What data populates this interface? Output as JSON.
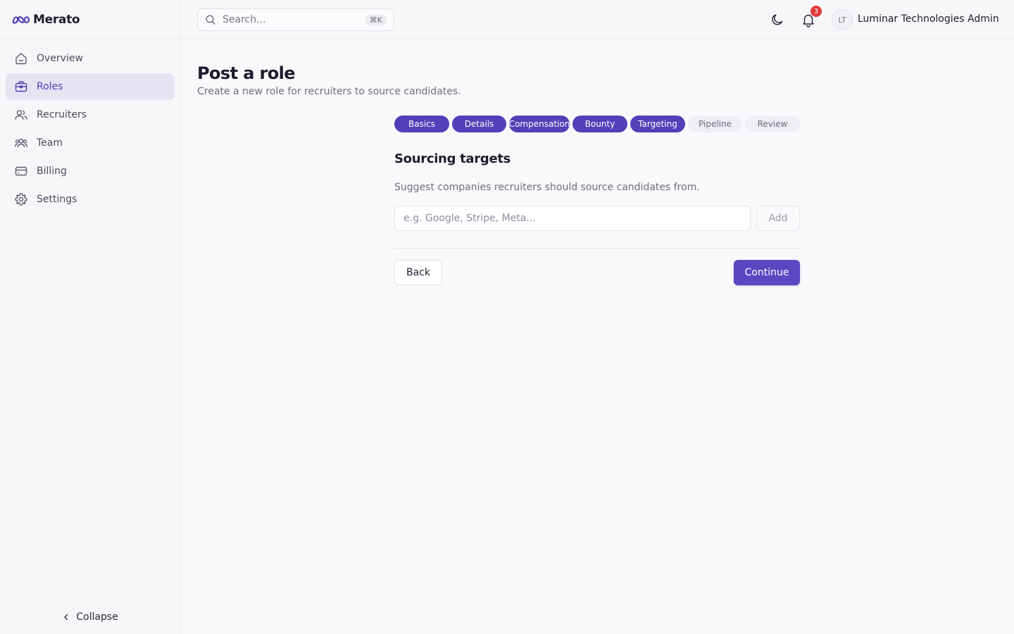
{
  "brand": {
    "name": "Merato",
    "accent": "#5140b8"
  },
  "sidebar": {
    "items": [
      {
        "label": "Overview",
        "icon": "home-icon",
        "active": false
      },
      {
        "label": "Roles",
        "icon": "briefcase-icon",
        "active": true
      },
      {
        "label": "Recruiters",
        "icon": "users-icon",
        "active": false
      },
      {
        "label": "Team",
        "icon": "team-icon",
        "active": false
      },
      {
        "label": "Billing",
        "icon": "credit-card-icon",
        "active": false
      },
      {
        "label": "Settings",
        "icon": "gear-icon",
        "active": false
      }
    ],
    "collapse_label": "Collapse"
  },
  "topbar": {
    "search_placeholder": "Search...",
    "search_shortcut": "⌘K",
    "notification_count": "3",
    "avatar_initials": "LT",
    "user_name": "Luminar Technologies Admin"
  },
  "page": {
    "title": "Post a role",
    "subtitle": "Create a new role for recruiters to source candidates."
  },
  "steps": [
    {
      "label": "Basics",
      "complete": true
    },
    {
      "label": "Details",
      "complete": true
    },
    {
      "label": "Compensation",
      "complete": true
    },
    {
      "label": "Bounty",
      "complete": true
    },
    {
      "label": "Targeting",
      "complete": true
    },
    {
      "label": "Pipeline",
      "complete": false
    },
    {
      "label": "Review",
      "complete": false
    }
  ],
  "section": {
    "title": "Sourcing targets",
    "description": "Suggest companies recruiters should source candidates from.",
    "input_placeholder": "e.g. Google, Stripe, Meta...",
    "input_value": "",
    "add_label": "Add"
  },
  "actions": {
    "back_label": "Back",
    "continue_label": "Continue"
  }
}
